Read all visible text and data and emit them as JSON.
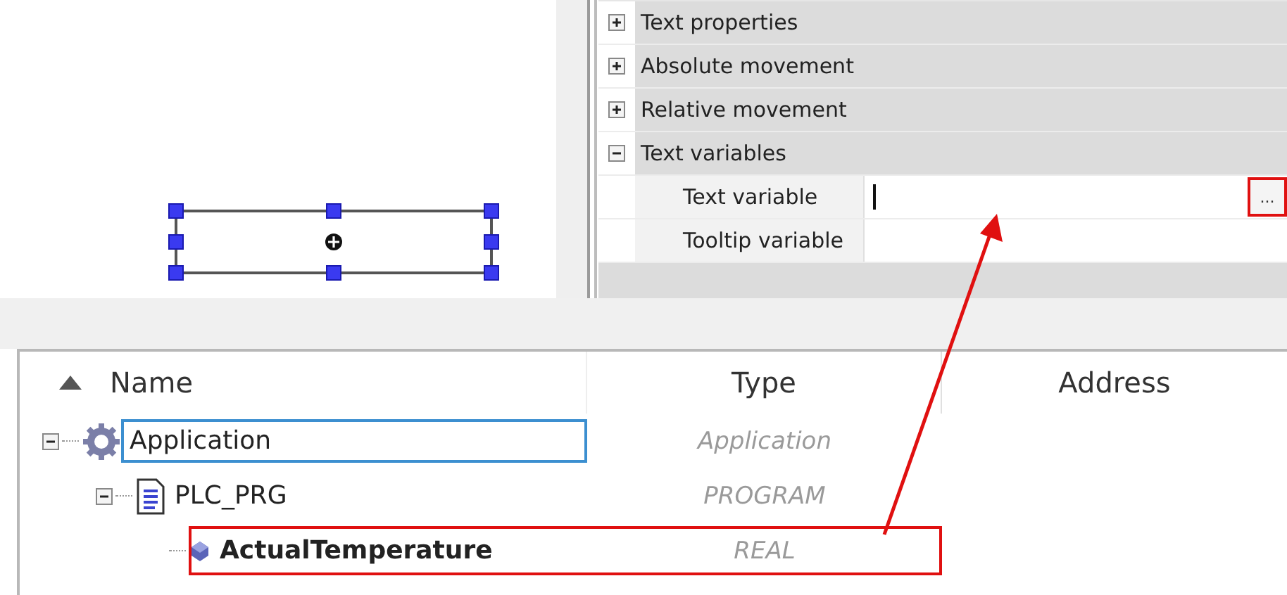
{
  "properties": [
    {
      "kind": "category",
      "label": "Text properties",
      "expanded": false
    },
    {
      "kind": "category",
      "label": "Absolute movement",
      "expanded": false
    },
    {
      "kind": "category",
      "label": "Relative movement",
      "expanded": false
    },
    {
      "kind": "category",
      "label": "Text variables",
      "expanded": true
    },
    {
      "kind": "property",
      "label": "Text variable",
      "editing": true,
      "browse": "...",
      "highlighted": true
    },
    {
      "kind": "property",
      "label": "Tooltip variable",
      "editing": false
    }
  ],
  "table": {
    "columns": [
      "Name",
      "Type",
      "Address"
    ],
    "rows": [
      {
        "name": "Application",
        "type": "Application",
        "kind": "application",
        "expanded": true,
        "selected": true,
        "highlighted": false,
        "children": [
          {
            "name": "PLC_PRG",
            "type": "PROGRAM",
            "kind": "program",
            "expanded": true,
            "selected": false,
            "highlighted": false,
            "children": [
              {
                "name": "ActualTemperature",
                "type": "REAL",
                "kind": "variable",
                "selected": false,
                "highlighted": true
              }
            ]
          }
        ]
      }
    ]
  }
}
